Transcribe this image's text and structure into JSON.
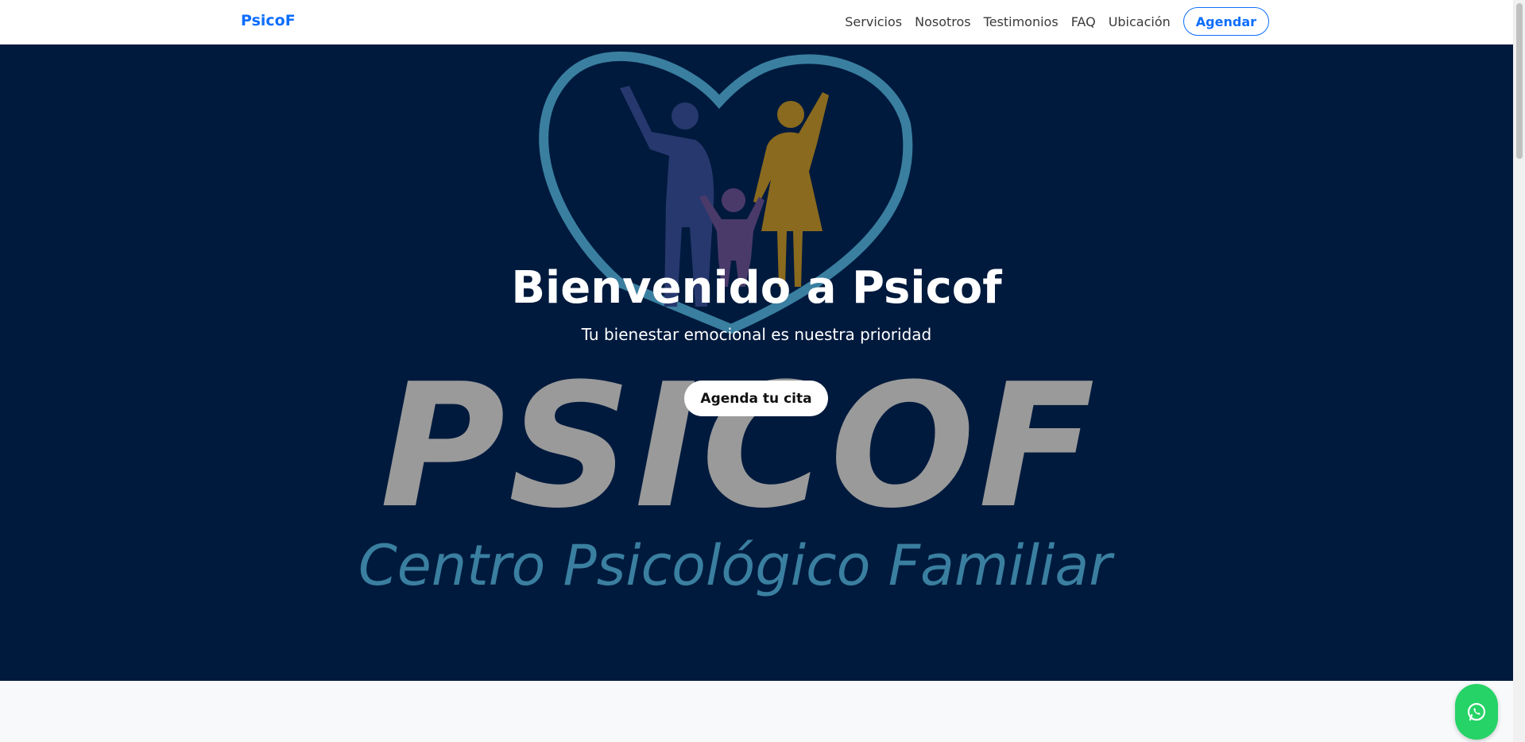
{
  "nav": {
    "brand": "PsicoF",
    "links": [
      "Servicios",
      "Nosotros",
      "Testimonios",
      "FAQ",
      "Ubicación"
    ],
    "cta": "Agendar"
  },
  "hero": {
    "title": "Bienvenido a Psicof",
    "subtitle": "Tu bienestar emocional es nuestra prioridad",
    "cta": "Agenda tu cita",
    "logo_wordmark": "PSICOF",
    "logo_tagline": "Centro Psicológico Familiar"
  },
  "colors": {
    "brand_blue": "#0d6efd",
    "hero_bg": "#001a3d",
    "whatsapp_green": "#25d366",
    "logo_heart": "#3a7fa0",
    "logo_text": "#9a9a9a"
  },
  "icons": {
    "floating_button": "whatsapp-icon"
  }
}
